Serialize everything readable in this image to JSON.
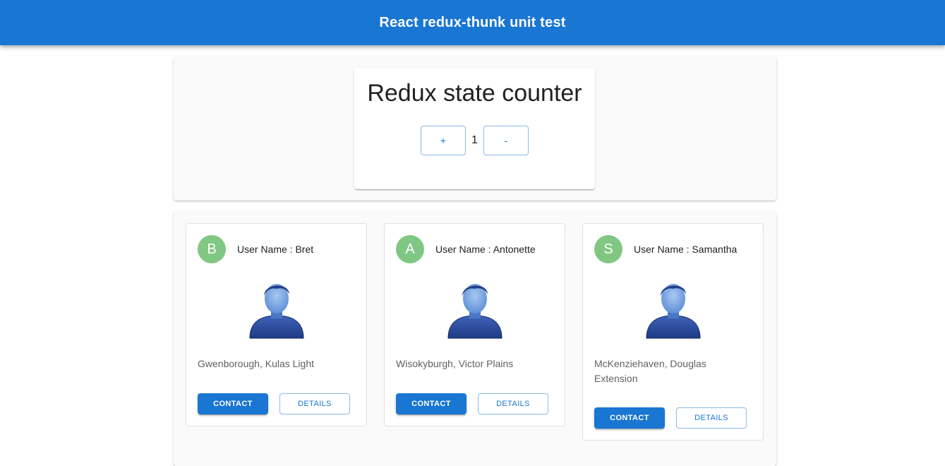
{
  "header": {
    "title": "React redux-thunk unit test"
  },
  "counter": {
    "title": "Redux state counter",
    "increment_label": "+",
    "value": "1",
    "decrement_label": "-"
  },
  "users": [
    {
      "initial": "B",
      "name_label": "User Name : Bret",
      "address": "Gwenborough, Kulas Light",
      "contact_label": "CONTACT",
      "details_label": "DETAILS"
    },
    {
      "initial": "A",
      "name_label": "User Name : Antonette",
      "address": "Wisokyburgh, Victor Plains",
      "contact_label": "CONTACT",
      "details_label": "DETAILS"
    },
    {
      "initial": "S",
      "name_label": "User Name : Samantha",
      "address": "McKenziehaven, Douglas Extension",
      "contact_label": "CONTACT",
      "details_label": "DETAILS"
    }
  ],
  "colors": {
    "primary": "#1976d2",
    "avatar": "#81c784",
    "panel_bg": "#fafafa"
  },
  "icons": {
    "user_image": "user-silhouette-icon"
  }
}
